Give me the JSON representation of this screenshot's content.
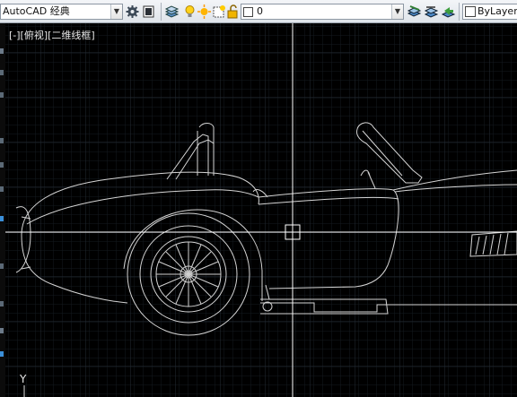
{
  "toolbar": {
    "workspace": "AutoCAD 经典",
    "layer_value": "0",
    "color_value": "ByLayer",
    "icons": [
      "gear-icon",
      "workspace-settings-icon",
      "layer-manager-icon",
      "bulb-on-icon",
      "sun-freeze-icon",
      "layer-color-icon",
      "lock-icon",
      "layer-state-icon",
      "make-current-layer-icon",
      "match-layer-icon",
      "layer-previous-icon",
      "color-swatch-icon"
    ]
  },
  "viewport": {
    "label": "[-][俯视][二维线框]",
    "ucs_axis": "Y"
  },
  "colors": {
    "drawing_bg": "#000000",
    "grid_minor": "#151a1f",
    "grid_major": "#222a33",
    "linework": "#d8d8d8",
    "crosshair": "#ffffff"
  }
}
